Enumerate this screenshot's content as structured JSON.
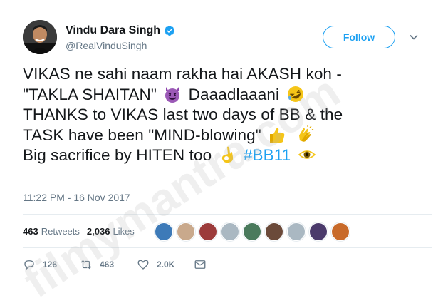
{
  "author": {
    "display_name": "Vindu Dara Singh",
    "handle": "@RealVinduSingh",
    "verified_icon": "verified-badge-icon"
  },
  "header": {
    "follow_label": "Follow",
    "menu_icon": "chevron-down-icon"
  },
  "tweet": {
    "line1": "VIKAS ne sahi naam rakha hai AKASH koh -",
    "line2_text": "\"TAKLA SHAITAN\"",
    "line2_after": "Daaadlaaani",
    "line3": "THANKS to VIKAS last two days of BB & the",
    "line4_text": "TASK have been \"MIND-blowing\"",
    "line5_text": "Big sacrifice by HITEN too",
    "hashtag": "#BB11",
    "emojis": [
      "smiling-devil-emoji",
      "rolling-laughing-emoji",
      "thumbs-up-emoji",
      "clapping-hands-emoji",
      "ok-hand-emoji",
      "eye-emoji"
    ]
  },
  "timestamp": "11:22 PM - 16 Nov 2017",
  "stats": {
    "retweets_count": "463",
    "retweets_label": "Retweets",
    "likes_count": "2,036",
    "likes_label": "Likes"
  },
  "likers_count": 9,
  "actions": {
    "reply_count": "126",
    "retweet_count": "463",
    "like_count": "2.0K",
    "icons": [
      "reply-icon",
      "retweet-icon",
      "like-icon",
      "direct-message-icon"
    ]
  },
  "colors": {
    "accent": "#1da1f2",
    "text": "#14171a",
    "secondary": "#657786",
    "divider": "#e6ecf0"
  },
  "watermark": "filmymantra.com"
}
